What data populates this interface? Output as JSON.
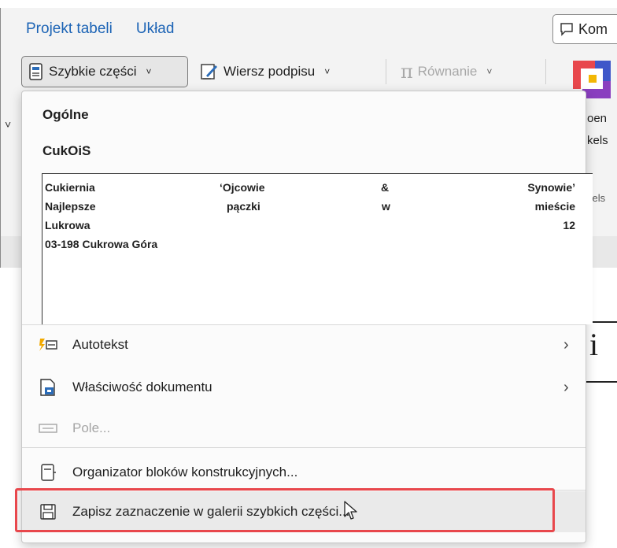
{
  "ribbon": {
    "tabs": [
      {
        "label": "Projekt tabeli"
      },
      {
        "label": "Układ"
      }
    ],
    "comments_button": "Kom",
    "quick_parts_button": "Szybkie części",
    "caption_button": "Wiersz podpisu",
    "equation_button": "Równanie",
    "side_text_1": "oen",
    "side_text_2": "kels",
    "side_text_3": "kels"
  },
  "menu": {
    "groups": [
      {
        "label": "Ogólne"
      },
      {
        "label": "CukOiS"
      }
    ],
    "preview": {
      "rows": [
        [
          "Cukiernia",
          "‘Ojcowie",
          "&",
          "Synowie’"
        ],
        [
          "Najlepsze",
          "pączki",
          "w",
          "mieście"
        ],
        [
          "Lukrowa",
          "",
          "",
          "12"
        ],
        [
          "03-198 Cukrowa Góra",
          "",
          "",
          ""
        ]
      ]
    },
    "items": [
      {
        "label": "Autotekst",
        "icon": "autotext-icon",
        "submenu": true,
        "enabled": true
      },
      {
        "label": "Właściwość dokumentu",
        "icon": "document-property-icon",
        "submenu": true,
        "enabled": true
      },
      {
        "label": "Pole...",
        "icon": "field-icon",
        "submenu": false,
        "enabled": false
      },
      {
        "label": "Organizator bloków konstrukcyjnych...",
        "icon": "building-blocks-icon",
        "submenu": false,
        "enabled": true
      },
      {
        "label": "Zapisz zaznaczenie w galerii szybkich części...",
        "icon": "save-icon",
        "submenu": false,
        "enabled": true
      }
    ]
  },
  "document": {
    "letter": "i"
  },
  "colors": {
    "accent": "#1b63b5",
    "highlight": "#e8474c"
  }
}
